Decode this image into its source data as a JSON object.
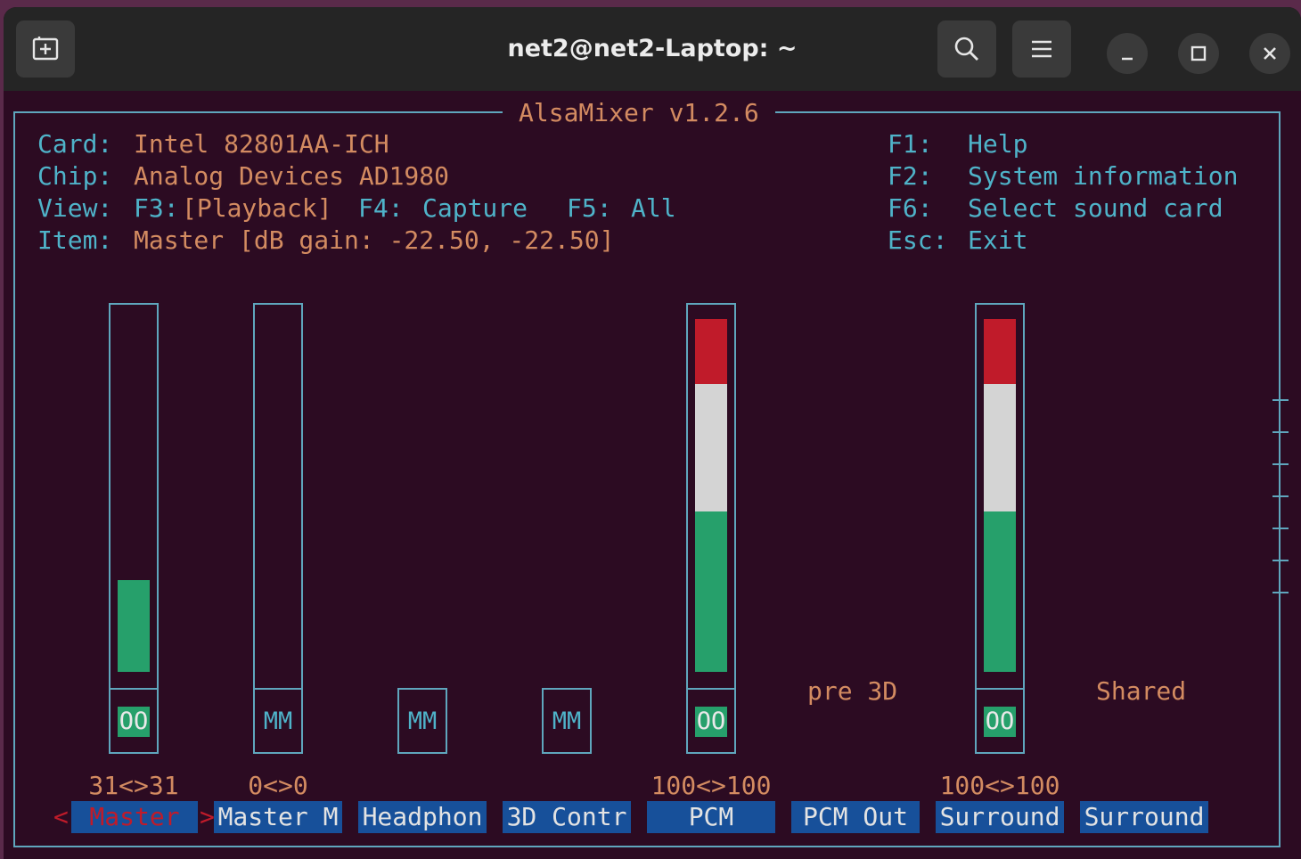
{
  "window": {
    "title": "net2@net2-Laptop: ~"
  },
  "header": {
    "app_title": "AlsaMixer v1.2.6",
    "card_label": "Card:",
    "card_value": "Intel 82801AA-ICH",
    "chip_label": "Chip:",
    "chip_value": "Analog Devices AD1980",
    "view_label": "View:",
    "view_f3": "F3:",
    "view_playback": "[Playback]",
    "view_f4": "F4:",
    "view_capture": "Capture",
    "view_f5": "F5:",
    "view_all": "All",
    "item_label": "Item:",
    "item_value": "Master [dB gain: -22.50, -22.50]"
  },
  "help": {
    "f1_key": "F1:",
    "f1_text": "Help",
    "f2_key": "F2:",
    "f2_text": "System information",
    "f6_key": "F6:",
    "f6_text": "Select sound card",
    "esc_key": "Esc:",
    "esc_text": "Exit"
  },
  "controls": [
    {
      "label": "Master",
      "value": "31<>31",
      "mute": "OO",
      "level": 0.26,
      "selected": true,
      "arrow_left": "<",
      "arrow_right": ">"
    },
    {
      "label": "Master M",
      "value": "0<>0",
      "mute": "MM",
      "level": 0.0
    },
    {
      "label": "Headphon",
      "mute": "MM"
    },
    {
      "label": "3D Contr",
      "mute": "MM"
    },
    {
      "label": "PCM",
      "value": "100<>100",
      "mute": "OO",
      "level": 1.0
    },
    {
      "label": "PCM Out",
      "text": "pre 3D"
    },
    {
      "label": "Surround",
      "value": "100<>100",
      "mute": "OO",
      "level": 1.0
    },
    {
      "label": "Surround",
      "text": "Shared"
    }
  ],
  "colors": {
    "bg": "#2c0b22",
    "cyan": "#4fb3c9",
    "orange": "#d38b61",
    "green": "#26a06b",
    "white": "#d4d4d4",
    "red": "#c01b2a",
    "label_bg": "#17509a"
  }
}
